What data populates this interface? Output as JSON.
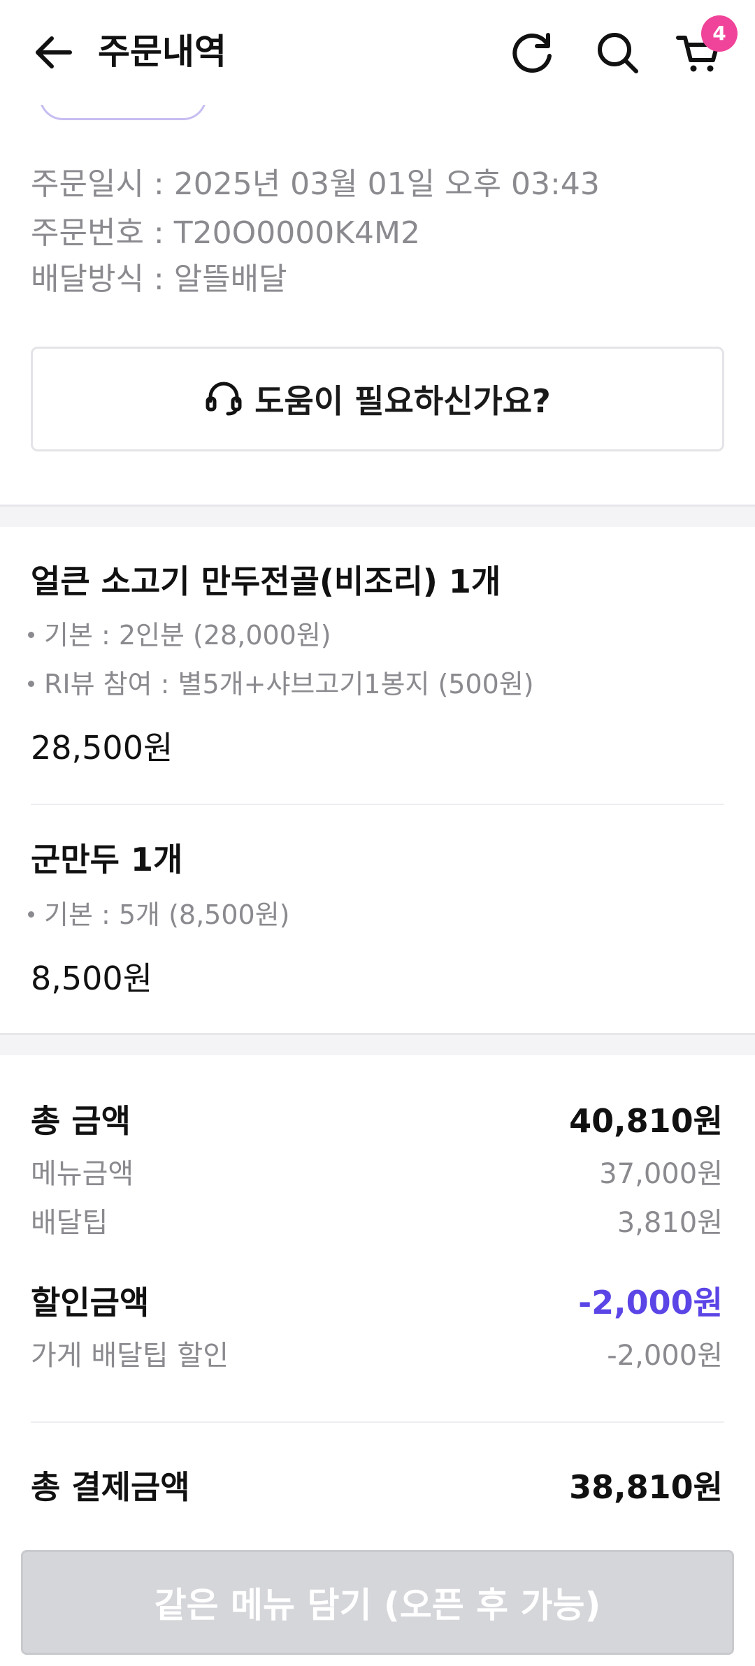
{
  "header": {
    "title": "주문내역",
    "back_icon": "arrow-left-icon",
    "refresh_icon": "refresh-icon",
    "search_icon": "search-icon",
    "cart_icon": "cart-icon",
    "cart_badge": "4",
    "badge_color": "#f0449a"
  },
  "order_info": {
    "date_label": "주문일시 : ",
    "date_value": "2025년 03월 01일 오후 03:43",
    "number_label": "주문번호 : ",
    "number_value": "T20O0000K4M2",
    "delivery_label": "배달방식 : ",
    "delivery_value": "알뜰배달"
  },
  "help_button": {
    "icon": "headset-icon",
    "label": "도움이 필요하신가요?"
  },
  "items": [
    {
      "title": "얼큰 소고기 만두전골(비조리) 1개",
      "options": [
        "기본 : 2인분 (28,000원)",
        "RI뷰 참여 : 별5개+샤브고기1봉지 (500원)"
      ],
      "price": "28,500원"
    },
    {
      "title": "군만두 1개",
      "options": [
        "기본 : 5개 (8,500원)"
      ],
      "price": "8,500원"
    }
  ],
  "summary": {
    "total_label": "총 금액",
    "total_value": "40,810원",
    "menu_label": "메뉴금액",
    "menu_value": "37,000원",
    "tip_label": "배달팁",
    "tip_value": "3,810원",
    "discount_label": "할인금액",
    "discount_value": "-2,000원",
    "discount_color": "#5b45e6",
    "store_discount_label": "가게 배달팁 할인",
    "store_discount_value": "-2,000원",
    "payment_label": "총 결제금액",
    "payment_value": "38,810원"
  },
  "cta": {
    "label": "같은 메뉴 담기 (오픈 후 가능)"
  }
}
